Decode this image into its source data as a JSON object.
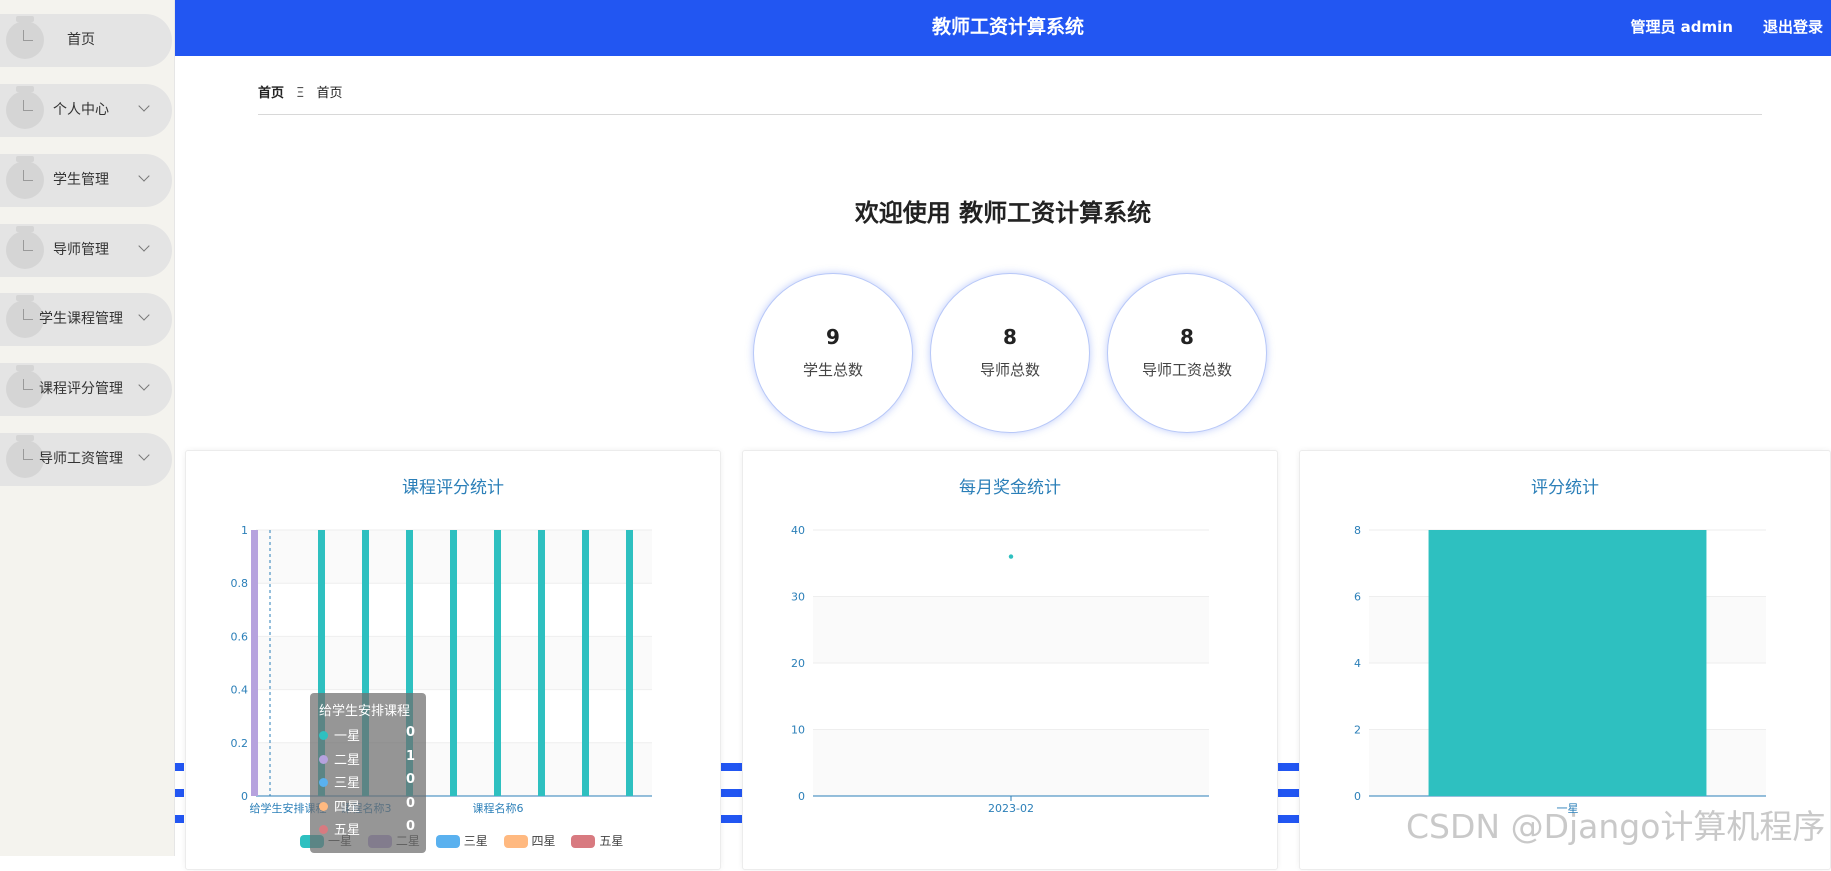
{
  "header": {
    "title": "教师工资计算系统",
    "user": "管理员 admin",
    "logout": "退出登录"
  },
  "sidebar": {
    "items": [
      {
        "label": "首页",
        "expandable": false
      },
      {
        "label": "个人中心",
        "expandable": true
      },
      {
        "label": "学生管理",
        "expandable": true
      },
      {
        "label": "导师管理",
        "expandable": true
      },
      {
        "label": "学生课程管理",
        "expandable": true
      },
      {
        "label": "课程评分管理",
        "expandable": true
      },
      {
        "label": "导师工资管理",
        "expandable": true
      }
    ]
  },
  "breadcrumb": {
    "first": "首页",
    "separator": "Ξ",
    "second": "首页"
  },
  "welcome": "欢迎使用 教师工资计算系统",
  "stats": [
    {
      "value": "9",
      "label": "学生总数"
    },
    {
      "value": "8",
      "label": "导师总数"
    },
    {
      "value": "8",
      "label": "导师工资总数"
    }
  ],
  "cards": [
    {
      "title": "课程评分统计"
    },
    {
      "title": "每月奖金统计"
    },
    {
      "title": "评分统计"
    }
  ],
  "colors": {
    "header": "#2256f2",
    "teal": "#2ec0c0",
    "purple": "#b6a2de",
    "blue": "#5ab1ef",
    "orange": "#ffb980",
    "red": "#d87a80",
    "title": "#2b7fb8"
  },
  "chart_data": [
    {
      "type": "bar",
      "title": "课程评分统计",
      "categories": [
        "给学生安排课程",
        "",
        "课程名称3",
        "",
        "",
        "课程名称6",
        "",
        "",
        ""
      ],
      "series": [
        {
          "name": "一星",
          "values": [
            0,
            1,
            1,
            1,
            1,
            1,
            1,
            1,
            1
          ]
        },
        {
          "name": "二星",
          "values": [
            1,
            0,
            0,
            0,
            0,
            0,
            0,
            0,
            0
          ]
        },
        {
          "name": "三星",
          "values": [
            0,
            0,
            0,
            0,
            0,
            0,
            0,
            0,
            0
          ]
        },
        {
          "name": "四星",
          "values": [
            0,
            0,
            0,
            0,
            0,
            0,
            0,
            0,
            0
          ]
        },
        {
          "name": "五星",
          "values": [
            0,
            0,
            0,
            0,
            0,
            0,
            0,
            0,
            0
          ]
        }
      ],
      "yticks": [
        "0",
        "0.2",
        "0.4",
        "0.6",
        "0.8",
        "1"
      ],
      "ylim": [
        0,
        1
      ],
      "tooltip": {
        "title": "给学生安排课程",
        "rows": [
          {
            "name": "一星",
            "value": "0"
          },
          {
            "name": "二星",
            "value": "1"
          },
          {
            "name": "三星",
            "value": "0"
          },
          {
            "name": "四星",
            "value": "0"
          },
          {
            "name": "五星",
            "value": "0"
          }
        ]
      }
    },
    {
      "type": "scatter",
      "title": "每月奖金统计",
      "categories": [
        "2023-02"
      ],
      "values": [
        36
      ],
      "yticks": [
        "0",
        "10",
        "20",
        "30",
        "40"
      ],
      "ylim": [
        0,
        40
      ]
    },
    {
      "type": "bar",
      "title": "评分统计",
      "categories": [
        "一星"
      ],
      "values": [
        8
      ],
      "yticks": [
        "0",
        "2",
        "4",
        "6",
        "8"
      ],
      "ylim": [
        0,
        8
      ]
    }
  ],
  "watermark": "CSDN @Django计算机程序"
}
